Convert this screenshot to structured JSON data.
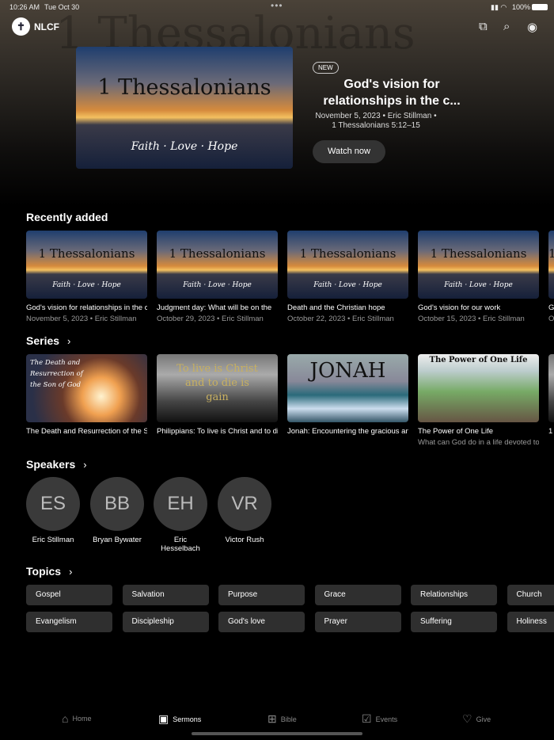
{
  "status": {
    "time": "10:26 AM",
    "date": "Tue Oct 30",
    "battery": "100%"
  },
  "header": {
    "brand": "NLCF",
    "bg_word": "1 Thessalonians"
  },
  "hero": {
    "image_title": "1 Thessalonians",
    "image_words": "Faith · Love · Hope",
    "badge": "NEW",
    "title": "God's vision for relationships in the c...",
    "meta": "November 5, 2023 • Eric Stillman • 1 Thessalonians 5:12–15",
    "button": "Watch now"
  },
  "recent": {
    "heading": "Recently added",
    "items": [
      {
        "img": "1 Thessalonians",
        "title": "God's vision for relationships in the church",
        "meta": "November 5, 2023 • Eric Stillman"
      },
      {
        "img": "1 Thessalonians",
        "title": "Judgment day: What will be on the",
        "meta": "October 29, 2023 • Eric Stillman"
      },
      {
        "img": "1 Thessalonians",
        "title": "Death and the Christian hope",
        "meta": "October 22, 2023 • Eric Stillman"
      },
      {
        "img": "1 Thessalonians",
        "title": "God's vision for our work",
        "meta": "October 15, 2023 • Eric Stillman"
      },
      {
        "img": "1 Thessalonians",
        "title": "G",
        "meta": "O"
      }
    ]
  },
  "series": {
    "heading": "Series",
    "items": [
      {
        "img": "The Death and Resurrection of the Son of God",
        "title": "The Death and Resurrection of the Son of God",
        "sub": ""
      },
      {
        "img": "To live is Christ and to die is gain",
        "title": "Philippians:  To live is Christ and to die is gain",
        "sub": ""
      },
      {
        "img": "JONAH",
        "title": "Jonah:  Encountering the gracious and compassionate God",
        "sub": ""
      },
      {
        "img": "The Power of One Life",
        "title": "The Power of One Life",
        "sub": "What can God do in a life devoted to Him?"
      },
      {
        "img": "",
        "title": "1",
        "sub": ""
      }
    ]
  },
  "speakers": {
    "heading": "Speakers",
    "items": [
      {
        "initials": "ES",
        "name": "Eric Stillman"
      },
      {
        "initials": "BB",
        "name": "Bryan Bywater"
      },
      {
        "initials": "EH",
        "name": "Eric Hesselbach"
      },
      {
        "initials": "VR",
        "name": "Victor Rush"
      }
    ]
  },
  "topics": {
    "heading": "Topics",
    "row1": [
      "Gospel",
      "Salvation",
      "Purpose",
      "Grace",
      "Relationships",
      "Church"
    ],
    "row2": [
      "Evangelism",
      "Discipleship",
      "God's love",
      "Prayer",
      "Suffering",
      "Holiness"
    ]
  },
  "tabs": [
    {
      "label": "Home"
    },
    {
      "label": "Sermons"
    },
    {
      "label": "Bible"
    },
    {
      "label": "Events"
    },
    {
      "label": "Give"
    }
  ]
}
